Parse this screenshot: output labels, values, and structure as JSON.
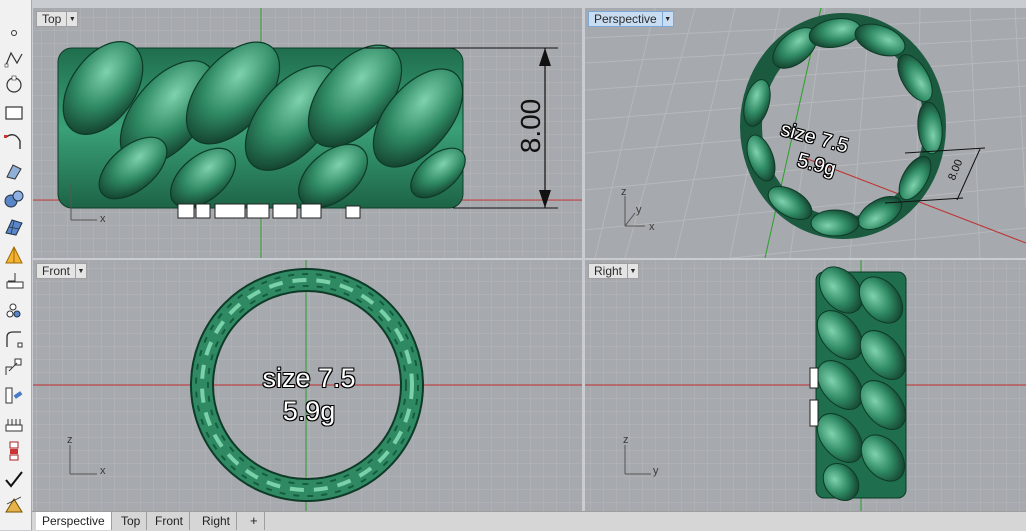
{
  "viewports": {
    "top": {
      "name": "Top",
      "dimension": "8.00",
      "axis_x": "x"
    },
    "perspective": {
      "name": "Perspective",
      "dimension": "8.00",
      "engraving_line1": "size 7.5",
      "engraving_line2": "5.9g",
      "axis_x": "x",
      "axis_y": "y",
      "axis_z": "z"
    },
    "front": {
      "name": "Front",
      "engraving_line1": "size 7.5",
      "engraving_line2": "5.9g",
      "axis_x": "x",
      "axis_z": "z"
    },
    "right": {
      "name": "Right",
      "axis_y": "y",
      "axis_z": "z"
    }
  },
  "tabs": [
    {
      "label": "Perspective",
      "active": true
    },
    {
      "label": "Top",
      "active": false
    },
    {
      "label": "Front",
      "active": false
    },
    {
      "label": "Right",
      "active": false
    }
  ],
  "add_tab_icon": "plus-icon",
  "toolbar_icons": [
    "point-icon",
    "polyline-icon",
    "circle-icon",
    "rectangle-icon",
    "curve-icon",
    "surface-icon",
    "solid-sphere-icon",
    "mesh-icon",
    "light-icon",
    "dimension-icon",
    "array-icon",
    "fillet-icon",
    "transform-icon",
    "analyze-icon",
    "render-icon",
    "check-icon",
    "layer-icon"
  ],
  "colors": {
    "ring_green": "#2f8a64",
    "viewport_bg": "#a6a9ad",
    "grid_line": "#b7babd",
    "axis_red": "#c03030",
    "axis_green": "#2aa02a",
    "active_title": "#c8dcf2"
  }
}
